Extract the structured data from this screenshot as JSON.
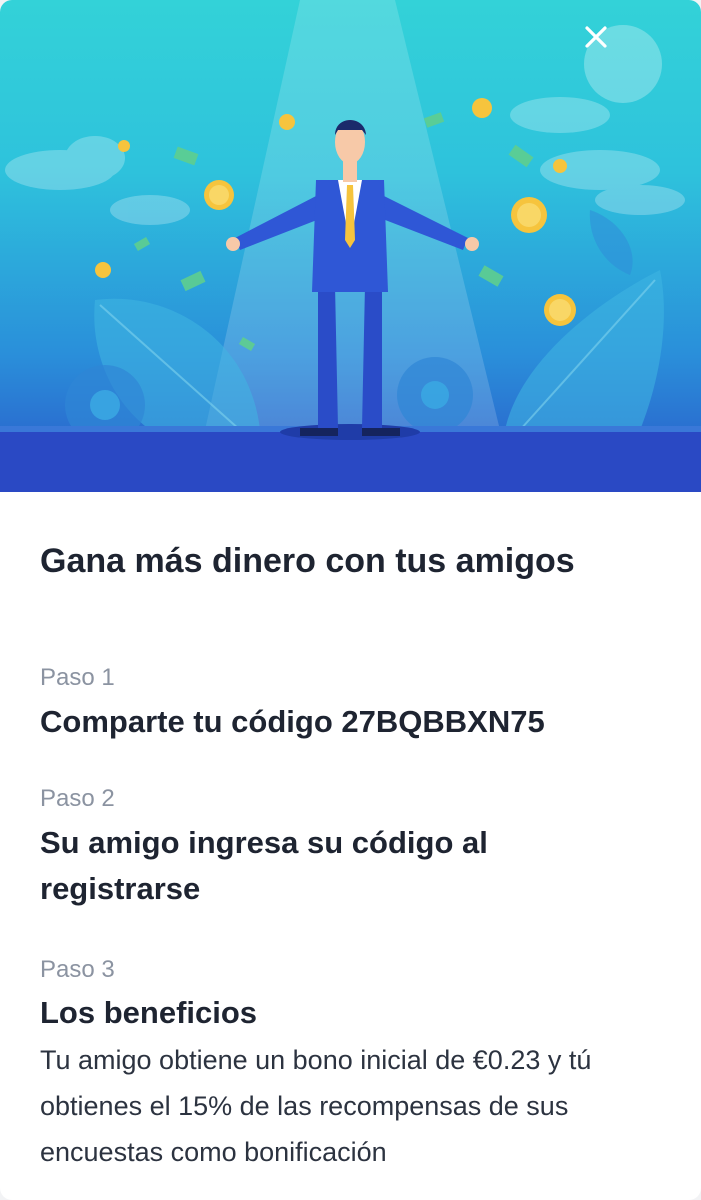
{
  "hero": {
    "close_icon": "close-icon",
    "illustration": "man-with-money-illustration"
  },
  "title": "Gana más dinero con tus amigos",
  "steps": [
    {
      "label": "Paso 1",
      "title": "Comparte tu código 27BQBBXN75"
    },
    {
      "label": "Paso 2",
      "title": "Su amigo ingresa su código al registrarse"
    },
    {
      "label": "Paso 3",
      "title": "Los beneficios",
      "description": "Tu amigo obtiene un bono inicial de €0.23 y tú obtienes el 15% de las recompensas de sus encuestas como bonificación"
    }
  ],
  "colors": {
    "title": "#1e2431",
    "step_label": "#8b93a1",
    "hero_top": "#33d2d8",
    "hero_bottom": "#2a56c8"
  }
}
